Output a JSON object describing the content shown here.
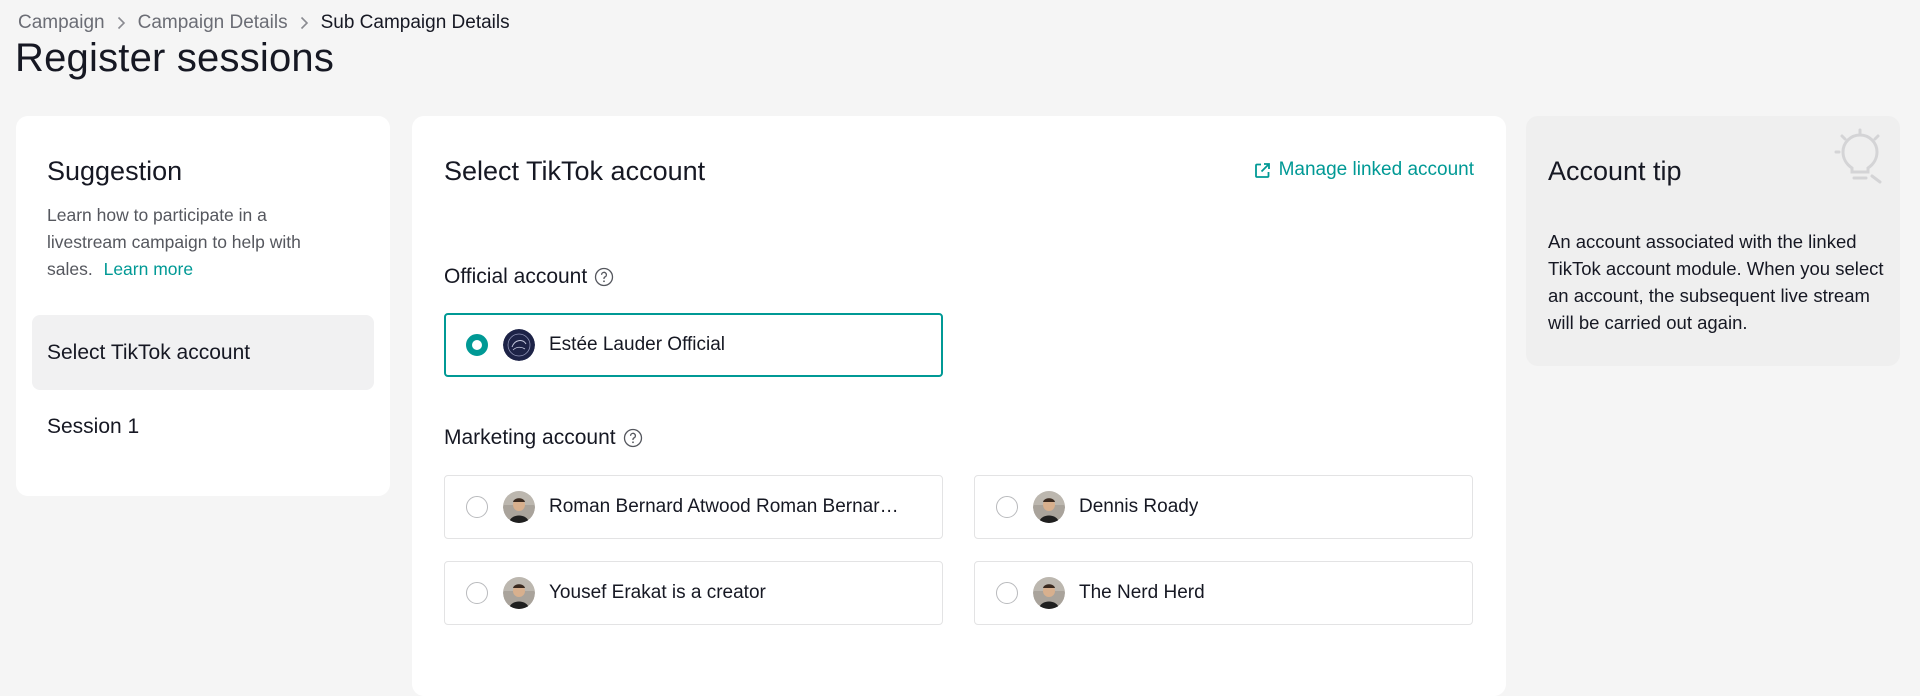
{
  "breadcrumb": {
    "items": [
      "Campaign",
      "Campaign Details",
      "Sub Campaign Details"
    ]
  },
  "page": {
    "title": "Register sessions"
  },
  "sidebar": {
    "title": "Suggestion",
    "description": "Learn how to participate in a livestream campaign to help with sales.",
    "learn_more": "Learn more",
    "items": [
      {
        "label": "Select TikTok account",
        "active": true
      },
      {
        "label": "Session 1",
        "active": false
      }
    ]
  },
  "main": {
    "title": "Select TikTok account",
    "manage_link": "Manage linked account",
    "official_label": "Official account",
    "marketing_label": "Marketing account",
    "official_accounts": [
      {
        "name": "Estée Lauder Official",
        "selected": true,
        "avatar": "estee-lauder-logo"
      }
    ],
    "marketing_accounts": [
      {
        "name": "Roman Bernard Atwood Roman Bernard Atwood",
        "selected": false,
        "avatar": "person-photo"
      },
      {
        "name": "Dennis Roady",
        "selected": false,
        "avatar": "person-photo"
      },
      {
        "name": "Yousef Erakat is a creator",
        "selected": false,
        "avatar": "person-photo"
      },
      {
        "name": "The Nerd Herd",
        "selected": false,
        "avatar": "person-photo"
      }
    ]
  },
  "tip": {
    "title": "Account tip",
    "body": "An account associated with the linked TikTok account module. When you select an account, the subsequent live stream will be carried out again."
  },
  "colors": {
    "accent": "#009995",
    "background": "#f5f5f5",
    "card": "#ffffff",
    "tip_card": "#efefef"
  }
}
